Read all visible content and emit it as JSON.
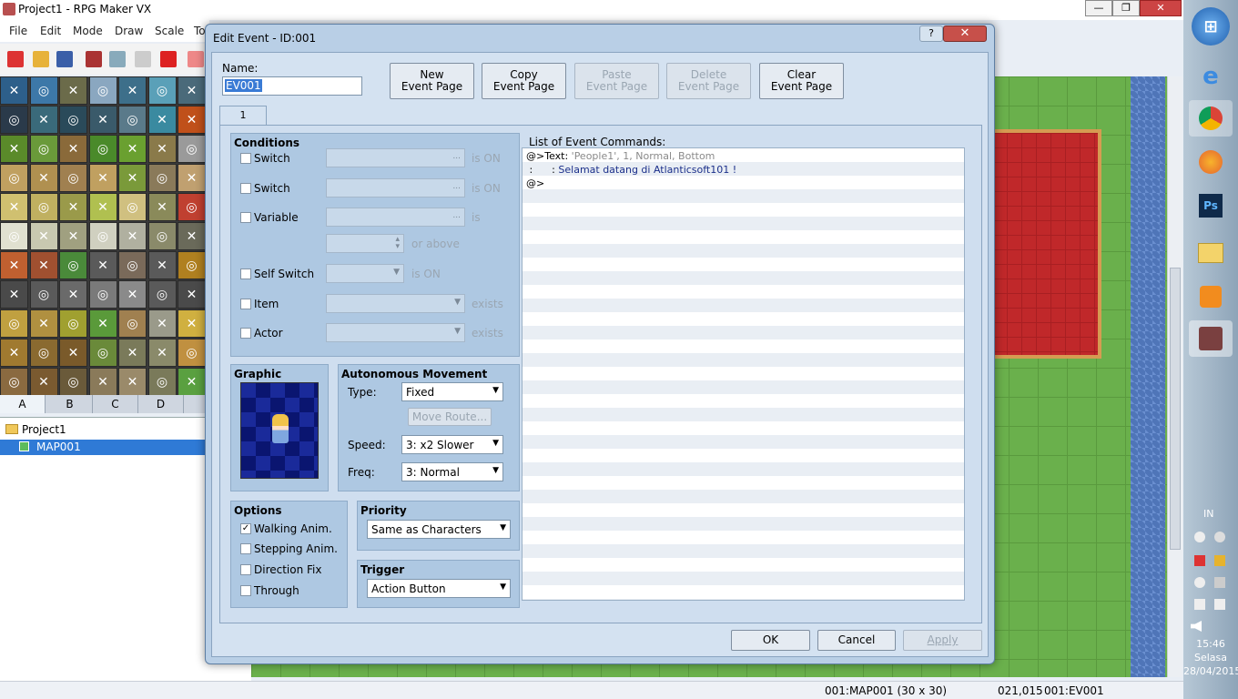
{
  "app": {
    "title": "Project1 - RPG Maker VX",
    "menu": [
      "File",
      "Edit",
      "Mode",
      "Draw",
      "Scale",
      "To"
    ],
    "tile_tabs": [
      "A",
      "B",
      "C",
      "D"
    ],
    "tree": {
      "root": "Project1",
      "map": "MAP001"
    },
    "status": {
      "map": "001:MAP001 (30 x 30)",
      "coords": "021,015",
      "event": "001:EV001"
    },
    "window_controls": {
      "minimize": "—",
      "restore": "❐",
      "close": "✕"
    }
  },
  "dialog": {
    "title": "Edit Event - ID:001",
    "help": "?",
    "close": "✕",
    "name_label": "Name:",
    "name_value": "EV001",
    "page_buttons": [
      {
        "line1": "New",
        "line2": "Event Page",
        "enabled": true
      },
      {
        "line1": "Copy",
        "line2": "Event Page",
        "enabled": true
      },
      {
        "line1": "Paste",
        "line2": "Event Page",
        "enabled": false
      },
      {
        "line1": "Delete",
        "line2": "Event Page",
        "enabled": false
      },
      {
        "line1": "Clear",
        "line2": "Event Page",
        "enabled": true
      }
    ],
    "tab": "1",
    "conditions": {
      "title": "Conditions",
      "switch1": "Switch",
      "switch1_suffix": "is ON",
      "switch2": "Switch",
      "switch2_suffix": "is ON",
      "variable": "Variable",
      "variable_suffix": "is",
      "variable_or_above": "or above",
      "self_switch": "Self Switch",
      "self_switch_suffix": "is ON",
      "item": "Item",
      "item_suffix": "exists",
      "actor": "Actor",
      "actor_suffix": "exists",
      "ellipsis": "..."
    },
    "graphic": {
      "title": "Graphic"
    },
    "autonomous": {
      "title": "Autonomous Movement",
      "type_label": "Type:",
      "type_value": "Fixed",
      "move_route": "Move Route...",
      "speed_label": "Speed:",
      "speed_value": "3: x2 Slower",
      "freq_label": "Freq:",
      "freq_value": "3: Normal"
    },
    "options": {
      "title": "Options",
      "walking": "Walking Anim.",
      "walking_checked": "✓",
      "stepping": "Stepping Anim.",
      "direction_fix": "Direction Fix",
      "through": "Through"
    },
    "priority": {
      "title": "Priority",
      "value": "Same as Characters"
    },
    "trigger": {
      "title": "Trigger",
      "value": "Action Button"
    },
    "commands": {
      "title": "List of Event Commands:",
      "line1_prefix": "@>Text: ",
      "line1_rest": "'People1', 1, Normal, Bottom",
      "line2_prefix": " :      : ",
      "line2_rest": "Selamat datang di Atlanticsoft101 !",
      "line3": "@>"
    },
    "ok": "OK",
    "cancel": "Cancel",
    "apply": "Apply"
  },
  "taskbar": {
    "input_lang": "IN",
    "time": "15:46",
    "day": "Selasa",
    "date": "28/04/2015",
    "apps": [
      "start",
      "ie",
      "chrome",
      "firefox",
      "photoshop",
      "explorer",
      "media-player",
      "rpg-maker"
    ]
  }
}
